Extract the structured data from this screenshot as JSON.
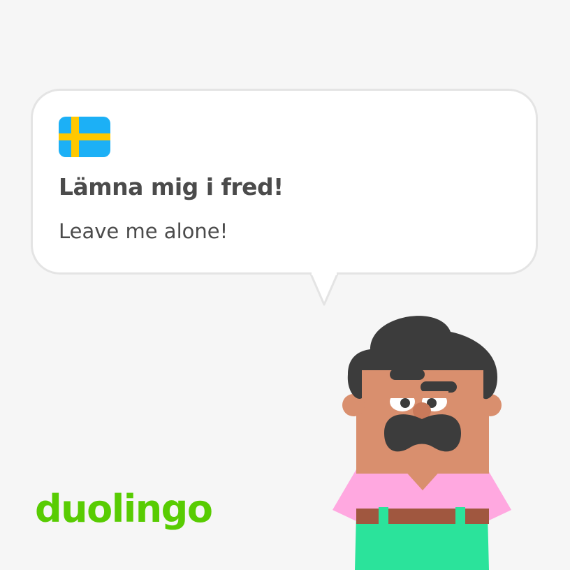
{
  "card": {
    "flag_icon": "sweden-flag-icon",
    "phrase": "Lämna mig i fred!",
    "translation": "Leave me alone!"
  },
  "brand": {
    "logo_text": "duolingo",
    "logo_color": "#58cc02"
  },
  "character": {
    "icon": "mustached-man-character",
    "skin_color": "#d98f6e",
    "hair_color": "#3c3c3c",
    "shirt_color": "#ffa8e0",
    "pants_color": "#2be39b",
    "belt_color": "#a0573f"
  },
  "colors": {
    "background": "#f6f6f6",
    "text": "#4b4b4b",
    "flag_blue": "#1cb0f6",
    "flag_yellow": "#ffc800"
  }
}
